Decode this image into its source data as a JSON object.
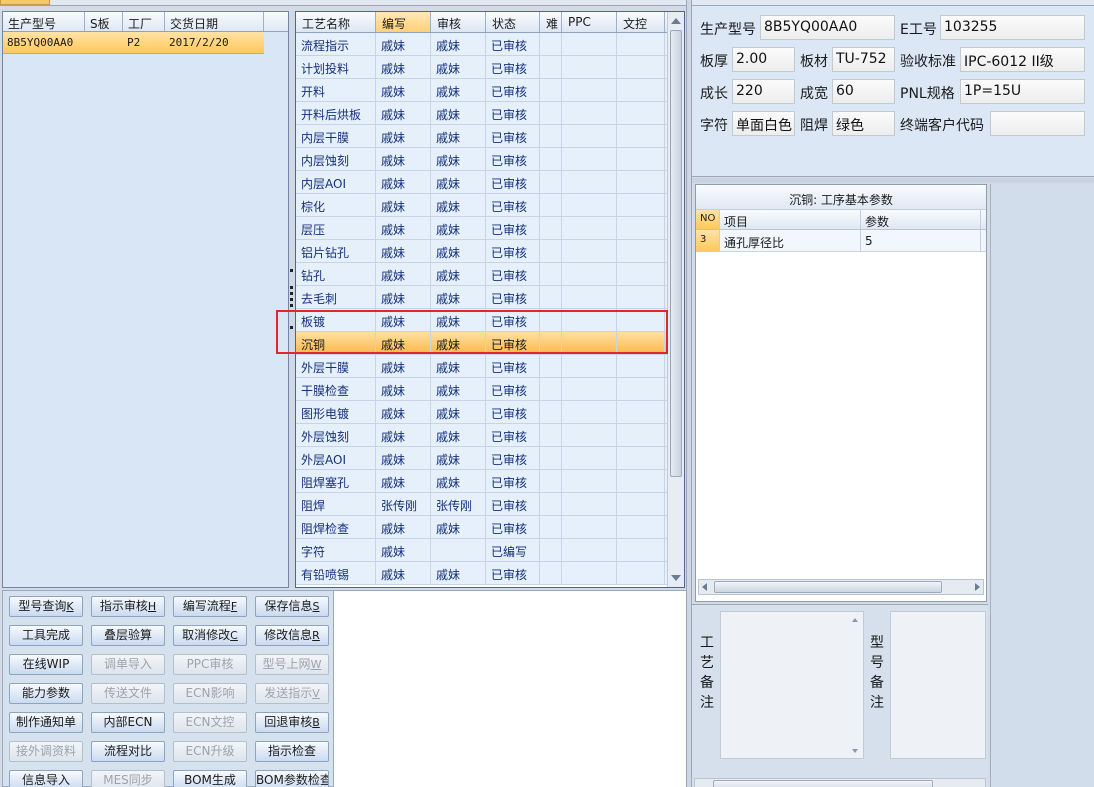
{
  "left_grid": {
    "headers": [
      "生产型号",
      "S板",
      "工厂",
      "交货日期"
    ],
    "rows": [
      {
        "model": "8B5YQ00AA0",
        "s_board": "",
        "factory": "P2",
        "date": "2017/2/20"
      }
    ]
  },
  "process_grid": {
    "headers": [
      "工艺名称",
      "编写",
      "审核",
      "状态",
      "难",
      "PPC",
      "文控"
    ],
    "rows": [
      {
        "name": "流程指示",
        "writer": "戚妹",
        "reviewer": "戚妹",
        "status": "已审核"
      },
      {
        "name": "计划投料",
        "writer": "戚妹",
        "reviewer": "戚妹",
        "status": "已审核"
      },
      {
        "name": "开料",
        "writer": "戚妹",
        "reviewer": "戚妹",
        "status": "已审核"
      },
      {
        "name": "开料后烘板",
        "writer": "戚妹",
        "reviewer": "戚妹",
        "status": "已审核"
      },
      {
        "name": "内层干膜",
        "writer": "戚妹",
        "reviewer": "戚妹",
        "status": "已审核"
      },
      {
        "name": "内层蚀刻",
        "writer": "戚妹",
        "reviewer": "戚妹",
        "status": "已审核"
      },
      {
        "name": "内层AOI",
        "writer": "戚妹",
        "reviewer": "戚妹",
        "status": "已审核"
      },
      {
        "name": "棕化",
        "writer": "戚妹",
        "reviewer": "戚妹",
        "status": "已审核"
      },
      {
        "name": "层压",
        "writer": "戚妹",
        "reviewer": "戚妹",
        "status": "已审核"
      },
      {
        "name": "铝片钻孔",
        "writer": "戚妹",
        "reviewer": "戚妹",
        "status": "已审核"
      },
      {
        "name": "钻孔",
        "writer": "戚妹",
        "reviewer": "戚妹",
        "status": "已审核"
      },
      {
        "name": "去毛刺",
        "writer": "戚妹",
        "reviewer": "戚妹",
        "status": "已审核"
      },
      {
        "name": "板镀",
        "writer": "戚妹",
        "reviewer": "戚妹",
        "status": "已审核"
      },
      {
        "name": "沉铜",
        "writer": "戚妹",
        "reviewer": "戚妹",
        "status": "已审核"
      },
      {
        "name": "外层干膜",
        "writer": "戚妹",
        "reviewer": "戚妹",
        "status": "已审核"
      },
      {
        "name": "干膜检查",
        "writer": "戚妹",
        "reviewer": "戚妹",
        "status": "已审核"
      },
      {
        "name": "图形电镀",
        "writer": "戚妹",
        "reviewer": "戚妹",
        "status": "已审核"
      },
      {
        "name": "外层蚀刻",
        "writer": "戚妹",
        "reviewer": "戚妹",
        "status": "已审核"
      },
      {
        "name": "外层AOI",
        "writer": "戚妹",
        "reviewer": "戚妹",
        "status": "已审核"
      },
      {
        "name": "阻焊塞孔",
        "writer": "戚妹",
        "reviewer": "戚妹",
        "status": "已审核"
      },
      {
        "name": "阻焊",
        "writer": "张传刚",
        "reviewer": "张传刚",
        "status": "已审核"
      },
      {
        "name": "阻焊检查",
        "writer": "戚妹",
        "reviewer": "戚妹",
        "status": "已审核"
      },
      {
        "name": "字符",
        "writer": "戚妹",
        "reviewer": "",
        "status": "已编写"
      },
      {
        "name": "有铅喷锡",
        "writer": "戚妹",
        "reviewer": "戚妹",
        "status": "已审核"
      }
    ],
    "selected_index": 13
  },
  "buttons": [
    {
      "label": "型号查询",
      "key": "K",
      "enabled": true
    },
    {
      "label": "指示审核",
      "key": "H",
      "enabled": true
    },
    {
      "label": "编写流程",
      "key": "F",
      "enabled": true
    },
    {
      "label": "保存信息",
      "key": "S",
      "enabled": true
    },
    {
      "label": "工具完成",
      "key": "",
      "enabled": true
    },
    {
      "label": "叠层验算",
      "key": "",
      "enabled": true
    },
    {
      "label": "取消修改",
      "key": "C",
      "enabled": true
    },
    {
      "label": "修改信息",
      "key": "R",
      "enabled": true
    },
    {
      "label": "在线WIP",
      "key": "",
      "enabled": true
    },
    {
      "label": "调单导入",
      "key": "",
      "enabled": false
    },
    {
      "label": "PPC审核",
      "key": "",
      "enabled": false
    },
    {
      "label": "型号上网",
      "key": "W",
      "enabled": false
    },
    {
      "label": "能力参数",
      "key": "",
      "enabled": true
    },
    {
      "label": "传送文件",
      "key": "",
      "enabled": false
    },
    {
      "label": "ECN影响",
      "key": "",
      "enabled": false
    },
    {
      "label": "发送指示",
      "key": "V",
      "enabled": false
    },
    {
      "label": "制作通知单",
      "key": "",
      "enabled": true
    },
    {
      "label": "内部ECN",
      "key": "",
      "enabled": true
    },
    {
      "label": "ECN文控",
      "key": "",
      "enabled": false
    },
    {
      "label": "回退审核",
      "key": "B",
      "enabled": true
    },
    {
      "label": "接外调资料",
      "key": "",
      "enabled": false
    },
    {
      "label": "流程对比",
      "key": "",
      "enabled": true
    },
    {
      "label": "ECN升级",
      "key": "",
      "enabled": false
    },
    {
      "label": "指示检查",
      "key": "",
      "enabled": true
    },
    {
      "label": "信息导入",
      "key": "",
      "enabled": true
    },
    {
      "label": "MES同步",
      "key": "",
      "enabled": false
    },
    {
      "label": "BOM生成",
      "key": "",
      "enabled": true
    },
    {
      "label": "BOM参数检查",
      "key": "",
      "enabled": true
    }
  ],
  "info": {
    "model_label": "生产型号",
    "model_value": "8B5YQ00AA0",
    "e_label": "E工号",
    "e_value": "103255",
    "thickness_label": "板厚",
    "thickness_value": "2.00",
    "material_label": "板材",
    "material_value": "TU-752",
    "standard_label": "验收标准",
    "standard_value": "IPC-6012 II级",
    "length_label": "成长",
    "length_value": "220",
    "width_label": "成宽",
    "width_value": "60",
    "pnl_label": "PNL规格",
    "pnl_value": "1P=15U",
    "char_label": "字符",
    "char_value": "单面白色",
    "mask_label": "阻焊",
    "mask_value": "绿色",
    "customer_label": "终端客户代码",
    "customer_value": ""
  },
  "params": {
    "title": "沉铜: 工序基本参数",
    "headers": [
      "NO",
      "项目",
      "参数"
    ],
    "rows": [
      {
        "no": "3",
        "item": "通孔厚径比",
        "value": "5"
      }
    ]
  },
  "remarks": {
    "process_label": "工艺备注",
    "model_label": "型号备注"
  },
  "colors": {
    "selection": "#fbb84a",
    "highlight_box": "#e2262b",
    "cell_text": "#14307a"
  }
}
